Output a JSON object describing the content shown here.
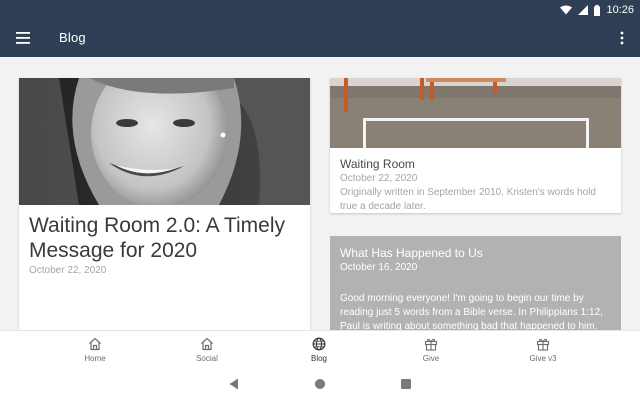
{
  "status_bar": {
    "time": "10:26"
  },
  "app_bar": {
    "title": "Blog",
    "menu_icon": "hamburger-menu-icon",
    "more_icon": "more-vertical-icon"
  },
  "featured_post": {
    "title": "Waiting Room 2.0: A Timely Message for 2020",
    "date": "October 22, 2020"
  },
  "posts": [
    {
      "title": "Waiting Room",
      "date": "October 22, 2020",
      "excerpt": "Originally written in September 2010, Kristen's words hold true a decade later."
    },
    {
      "title": "What Has Happened to Us",
      "date": "October 16, 2020",
      "excerpt": "Good morning everyone!  I'm going to begin our time by reading just 5 words from a Bible verse.  In Philippians 1:12, Paul is writing about something bad that happened to him."
    }
  ],
  "bottom_nav": {
    "items": [
      {
        "label": "Home",
        "icon": "home-icon"
      },
      {
        "label": "Social",
        "icon": "home-icon"
      },
      {
        "label": "Blog",
        "icon": "globe-icon"
      },
      {
        "label": "Give",
        "icon": "gift-icon"
      },
      {
        "label": "Give v3",
        "icon": "gift-icon"
      }
    ],
    "active_label": "Blog"
  },
  "colors": {
    "app_bar": "#2f4056",
    "placeholder_card": "#b2b2b2"
  }
}
